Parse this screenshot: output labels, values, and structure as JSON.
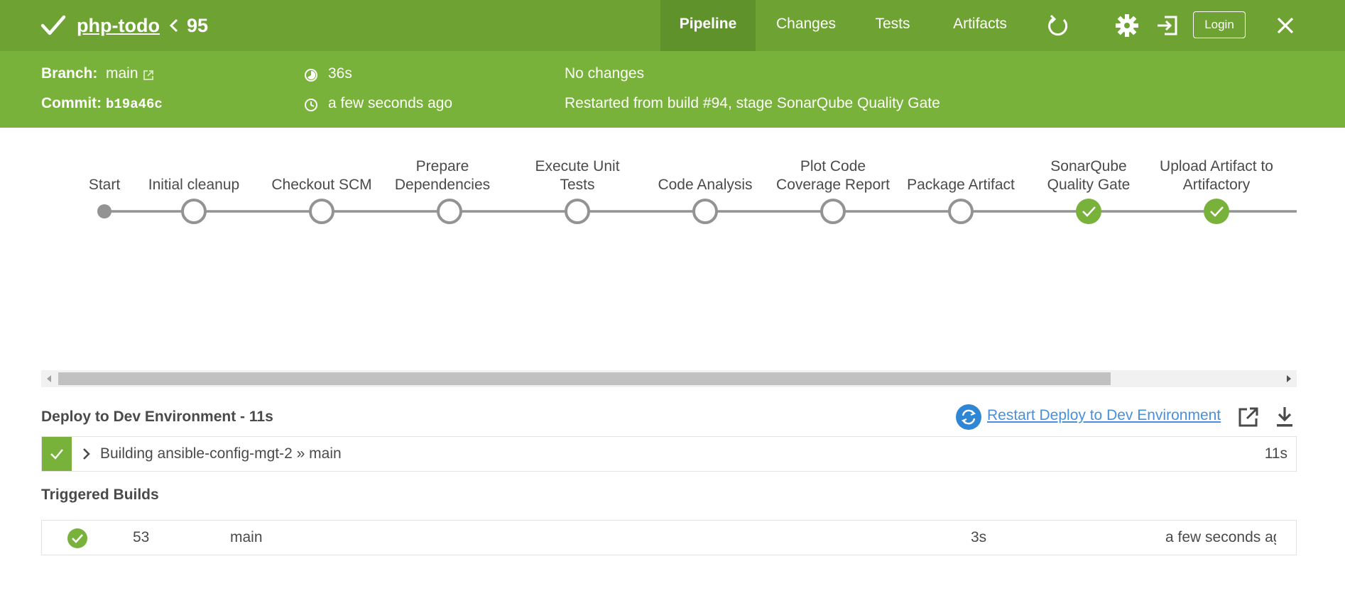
{
  "header": {
    "pipeline_name": "php-todo",
    "build_number": "95",
    "tabs": [
      {
        "label": "Pipeline",
        "active": true
      },
      {
        "label": "Changes",
        "active": false
      },
      {
        "label": "Tests",
        "active": false
      },
      {
        "label": "Artifacts",
        "active": false
      }
    ],
    "login_label": "Login",
    "colors": {
      "topbar": "#6ea334",
      "infobar": "#79b23a",
      "active_tab": "#5f922a"
    }
  },
  "info": {
    "branch_label": "Branch:",
    "branch_value": "main",
    "commit_label": "Commit:",
    "commit_value": "b19a46c",
    "duration": "36s",
    "time_ago": "a few seconds ago",
    "changes": "No changes",
    "cause": "Restarted from build #94, stage SonarQube Quality Gate"
  },
  "pipeline": {
    "stages": [
      {
        "label": "Start",
        "status": "start"
      },
      {
        "label": "Initial cleanup",
        "status": "not-built"
      },
      {
        "label": "Checkout SCM",
        "status": "not-built"
      },
      {
        "label": "Prepare Dependencies",
        "status": "not-built"
      },
      {
        "label": "Execute Unit Tests",
        "status": "not-built"
      },
      {
        "label": "Code Analysis",
        "status": "not-built"
      },
      {
        "label": "Plot Code Coverage Report",
        "status": "not-built"
      },
      {
        "label": "Package Artifact",
        "status": "not-built"
      },
      {
        "label": "SonarQube Quality Gate",
        "status": "success"
      },
      {
        "label": "Upload Artifact to Artifactory",
        "status": "success"
      }
    ]
  },
  "detail": {
    "stage_title": "Deploy to Dev Environment - 11s",
    "restart_label": "Restart Deploy to Dev Environment",
    "step": {
      "text": "Building ansible-config-mgt-2 » main",
      "duration": "11s"
    }
  },
  "triggered": {
    "title": "Triggered Builds",
    "builds": [
      {
        "number": "53",
        "branch": "main",
        "duration": "3s",
        "time": "a few seconds ag"
      }
    ]
  }
}
